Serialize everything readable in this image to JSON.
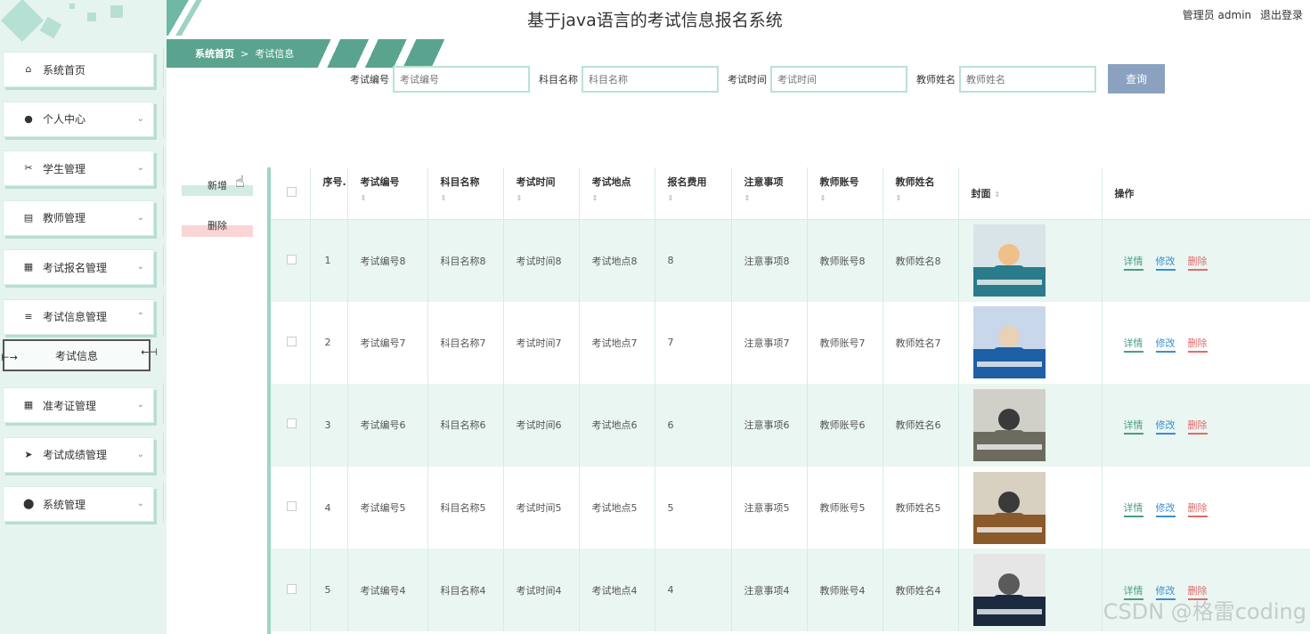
{
  "header": {
    "title": "基于java语言的考试信息报名系统",
    "user": "管理员 admin",
    "logout": "退出登录"
  },
  "breadcrumb": {
    "home": "系统首页",
    "separator": ">",
    "current": "考试信息"
  },
  "sidebar": {
    "items": [
      {
        "label": "系统首页",
        "icon": "home-icon",
        "chevron": ""
      },
      {
        "label": "个人中心",
        "icon": "user-icon",
        "chevron": "⌄"
      },
      {
        "label": "学生管理",
        "icon": "ticket-icon",
        "chevron": "⌄"
      },
      {
        "label": "教师管理",
        "icon": "clipboard-icon",
        "chevron": "⌄"
      },
      {
        "label": "考试报名管理",
        "icon": "grid-icon",
        "chevron": "⌄"
      },
      {
        "label": "考试信息管理",
        "icon": "list-icon",
        "chevron": "⌃"
      },
      {
        "label": "准考证管理",
        "icon": "grid-icon",
        "chevron": "⌄"
      },
      {
        "label": "考试成绩管理",
        "icon": "send-icon",
        "chevron": "⌄"
      },
      {
        "label": "系统管理",
        "icon": "pin-icon",
        "chevron": "⌄"
      }
    ],
    "active_sub": "考试信息"
  },
  "search": {
    "fields": [
      {
        "label": "考试编号",
        "placeholder": "考试编号"
      },
      {
        "label": "科目名称",
        "placeholder": "科目名称"
      },
      {
        "label": "考试时间",
        "placeholder": "考试时间"
      },
      {
        "label": "教师姓名",
        "placeholder": "教师姓名"
      }
    ],
    "button": "查询"
  },
  "actions": {
    "add": "新增",
    "delete": "删除"
  },
  "table": {
    "columns": [
      "序号.",
      "考试编号",
      "科目名称",
      "考试时间",
      "考试地点",
      "报名费用",
      "注意事项",
      "教师账号",
      "教师姓名",
      "封面",
      "操作"
    ],
    "rows": [
      {
        "no": "1",
        "exam_no": "考试编号8",
        "subject": "科目名称8",
        "time": "考试时间8",
        "place": "考试地点8",
        "fee": "8",
        "notes": "注意事项8",
        "account": "教师账号8",
        "teacher": "教师姓名8"
      },
      {
        "no": "2",
        "exam_no": "考试编号7",
        "subject": "科目名称7",
        "time": "考试时间7",
        "place": "考试地点7",
        "fee": "7",
        "notes": "注意事项7",
        "account": "教师账号7",
        "teacher": "教师姓名7"
      },
      {
        "no": "3",
        "exam_no": "考试编号6",
        "subject": "科目名称6",
        "time": "考试时间6",
        "place": "考试地点6",
        "fee": "6",
        "notes": "注意事项6",
        "account": "教师账号6",
        "teacher": "教师姓名6"
      },
      {
        "no": "4",
        "exam_no": "考试编号5",
        "subject": "科目名称5",
        "time": "考试时间5",
        "place": "考试地点5",
        "fee": "5",
        "notes": "注意事项5",
        "account": "教师账号5",
        "teacher": "教师姓名5"
      },
      {
        "no": "5",
        "exam_no": "考试编号4",
        "subject": "科目名称4",
        "time": "考试时间4",
        "place": "考试地点4",
        "fee": "4",
        "notes": "注意事项4",
        "account": "教师账号4",
        "teacher": "教师姓名4"
      }
    ],
    "ops": {
      "detail": "详情",
      "edit": "修改",
      "remove": "删除"
    }
  },
  "watermark": "CSDN @格雷coding",
  "colors": {
    "accent": "#5aa48f",
    "sidebar_bg": "#e6f4ef",
    "query_btn": "#8aa2bf",
    "danger": "#e06b6b",
    "link": "#3a8fd0"
  }
}
